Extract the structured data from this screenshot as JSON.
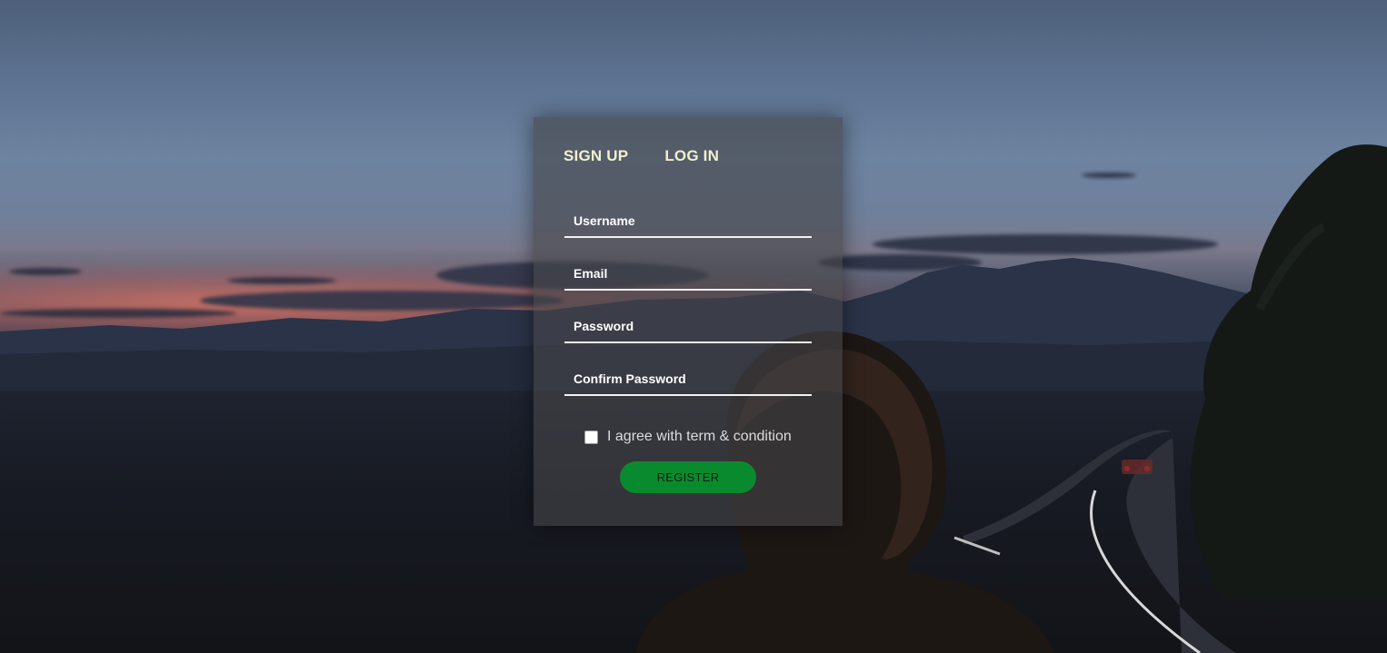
{
  "tabs": {
    "signup": "SIGN UP",
    "login": "LOG IN"
  },
  "form": {
    "username_placeholder": "Username",
    "email_placeholder": "Email",
    "password_placeholder": "Password",
    "confirm_placeholder": "Confirm Password",
    "agree_label": "I agree with term & condition",
    "register_label": "REGISTER"
  },
  "colors": {
    "tab_text": "#f3efcf",
    "register_button": "#0a8a2e",
    "card_background": "rgba(70,70,72,0.62)"
  }
}
